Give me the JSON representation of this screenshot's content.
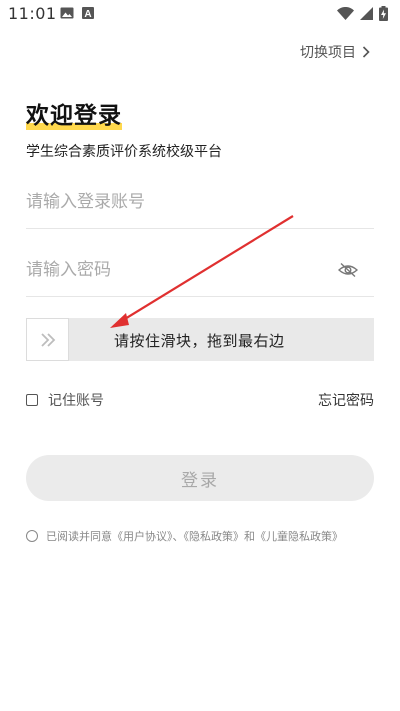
{
  "status_bar": {
    "time": "11:01",
    "icons": [
      "image-icon",
      "a-notification-icon",
      "wifi-icon",
      "signal-icon",
      "battery-charging-icon"
    ]
  },
  "header": {
    "switch_project_label": "切换项目",
    "chevron_icon": "chevron-right-icon"
  },
  "login": {
    "title": "欢迎登录",
    "subtitle": "学生综合素质评价系统校级平台",
    "accent_color": "#ffd84d",
    "account_placeholder": "请输入登录账号",
    "account_value": "",
    "password_placeholder": "请输入密码",
    "password_value": "",
    "password_toggle_icon": "eye-off-icon"
  },
  "slider": {
    "handle_icon": "double-chevron-right-icon",
    "text": "请按住滑块，拖到最右边",
    "progress": 0
  },
  "options": {
    "remember_label": "记住账号",
    "remember_checked": false,
    "forgot_label": "忘记密码"
  },
  "actions": {
    "login_label": "登录"
  },
  "agreement": {
    "checked": false,
    "prefix": "已阅读并同意",
    "user_agreement": "《用户协议》",
    "sep1": "、",
    "privacy_policy": "《隐私政策》",
    "and": "和",
    "children_privacy_policy": "《儿童隐私政策》"
  },
  "annotation": {
    "arrow_color": "#e03030"
  }
}
